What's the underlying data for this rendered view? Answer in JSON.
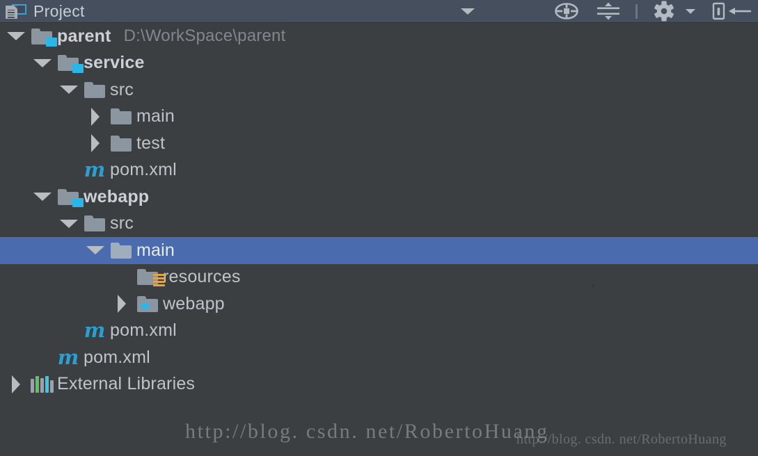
{
  "window": {
    "title": "Project",
    "tool_window_icon": "project-tool-window-icon"
  },
  "toolbar": {
    "buttons": [
      {
        "name": "view-options-dropdown",
        "icon": "chevron-down-icon",
        "label": ""
      },
      {
        "name": "scroll-from-source-button",
        "icon": "target-crosshair-icon",
        "label": ""
      },
      {
        "name": "collapse-all-button",
        "icon": "collapse-all-icon",
        "label": ""
      },
      {
        "name": "settings-gear-button",
        "icon": "gear-icon",
        "label": ""
      },
      {
        "name": "hide-panel-button",
        "icon": "hide-left-arrow-icon",
        "label": ""
      }
    ]
  },
  "tree": {
    "rows": [
      {
        "label": "parent",
        "sublabel": "D:\\WorkSpace\\parent",
        "depth": 0,
        "twisty": "expanded",
        "icon": "maven-module-folder-icon",
        "bold": true,
        "selected": false
      },
      {
        "label": "service",
        "sublabel": "",
        "depth": 1,
        "twisty": "expanded",
        "icon": "maven-module-folder-icon",
        "bold": true,
        "selected": false
      },
      {
        "label": "src",
        "sublabel": "",
        "depth": 2,
        "twisty": "expanded",
        "icon": "folder-icon",
        "bold": false,
        "selected": false
      },
      {
        "label": "main",
        "sublabel": "",
        "depth": 3,
        "twisty": "collapsed",
        "icon": "folder-icon",
        "bold": false,
        "selected": false
      },
      {
        "label": "test",
        "sublabel": "",
        "depth": 3,
        "twisty": "collapsed",
        "icon": "folder-icon",
        "bold": false,
        "selected": false
      },
      {
        "label": "pom.xml",
        "sublabel": "",
        "depth": 2,
        "twisty": "none",
        "icon": "maven-pom-icon",
        "bold": false,
        "selected": false
      },
      {
        "label": "webapp",
        "sublabel": "",
        "depth": 1,
        "twisty": "expanded",
        "icon": "maven-module-folder-icon",
        "bold": true,
        "selected": false
      },
      {
        "label": "src",
        "sublabel": "",
        "depth": 2,
        "twisty": "expanded",
        "icon": "folder-icon",
        "bold": false,
        "selected": false
      },
      {
        "label": "main",
        "sublabel": "",
        "depth": 3,
        "twisty": "expanded",
        "icon": "folder-icon",
        "bold": false,
        "selected": true
      },
      {
        "label": "resources",
        "sublabel": "",
        "depth": 4,
        "twisty": "none",
        "icon": "resources-folder-icon",
        "bold": false,
        "selected": false
      },
      {
        "label": "webapp",
        "sublabel": "",
        "depth": 4,
        "twisty": "collapsed",
        "icon": "webapp-folder-icon",
        "bold": false,
        "selected": false
      },
      {
        "label": "pom.xml",
        "sublabel": "",
        "depth": 2,
        "twisty": "none",
        "icon": "maven-pom-icon",
        "bold": false,
        "selected": false
      },
      {
        "label": "pom.xml",
        "sublabel": "",
        "depth": 1,
        "twisty": "none",
        "icon": "maven-pom-icon",
        "bold": false,
        "selected": false
      },
      {
        "label": "External Libraries",
        "sublabel": "",
        "depth": 0,
        "twisty": "collapsed",
        "icon": "external-libraries-icon",
        "bold": false,
        "selected": false
      }
    ]
  },
  "watermarks": {
    "primary": "http://blog. csdn. net/RobertoHuang",
    "secondary": "http://blog. csdn. net/RobertoHuang"
  },
  "colors": {
    "background": "#3c3f41",
    "header_background": "#454f5e",
    "selection": "#4a6cae",
    "text": "#bfc4c9",
    "text_dim": "#80878f",
    "accent_blue": "#29b6e8",
    "accent_orange": "#e8a33d",
    "folder_gray": "#8b96a0"
  }
}
